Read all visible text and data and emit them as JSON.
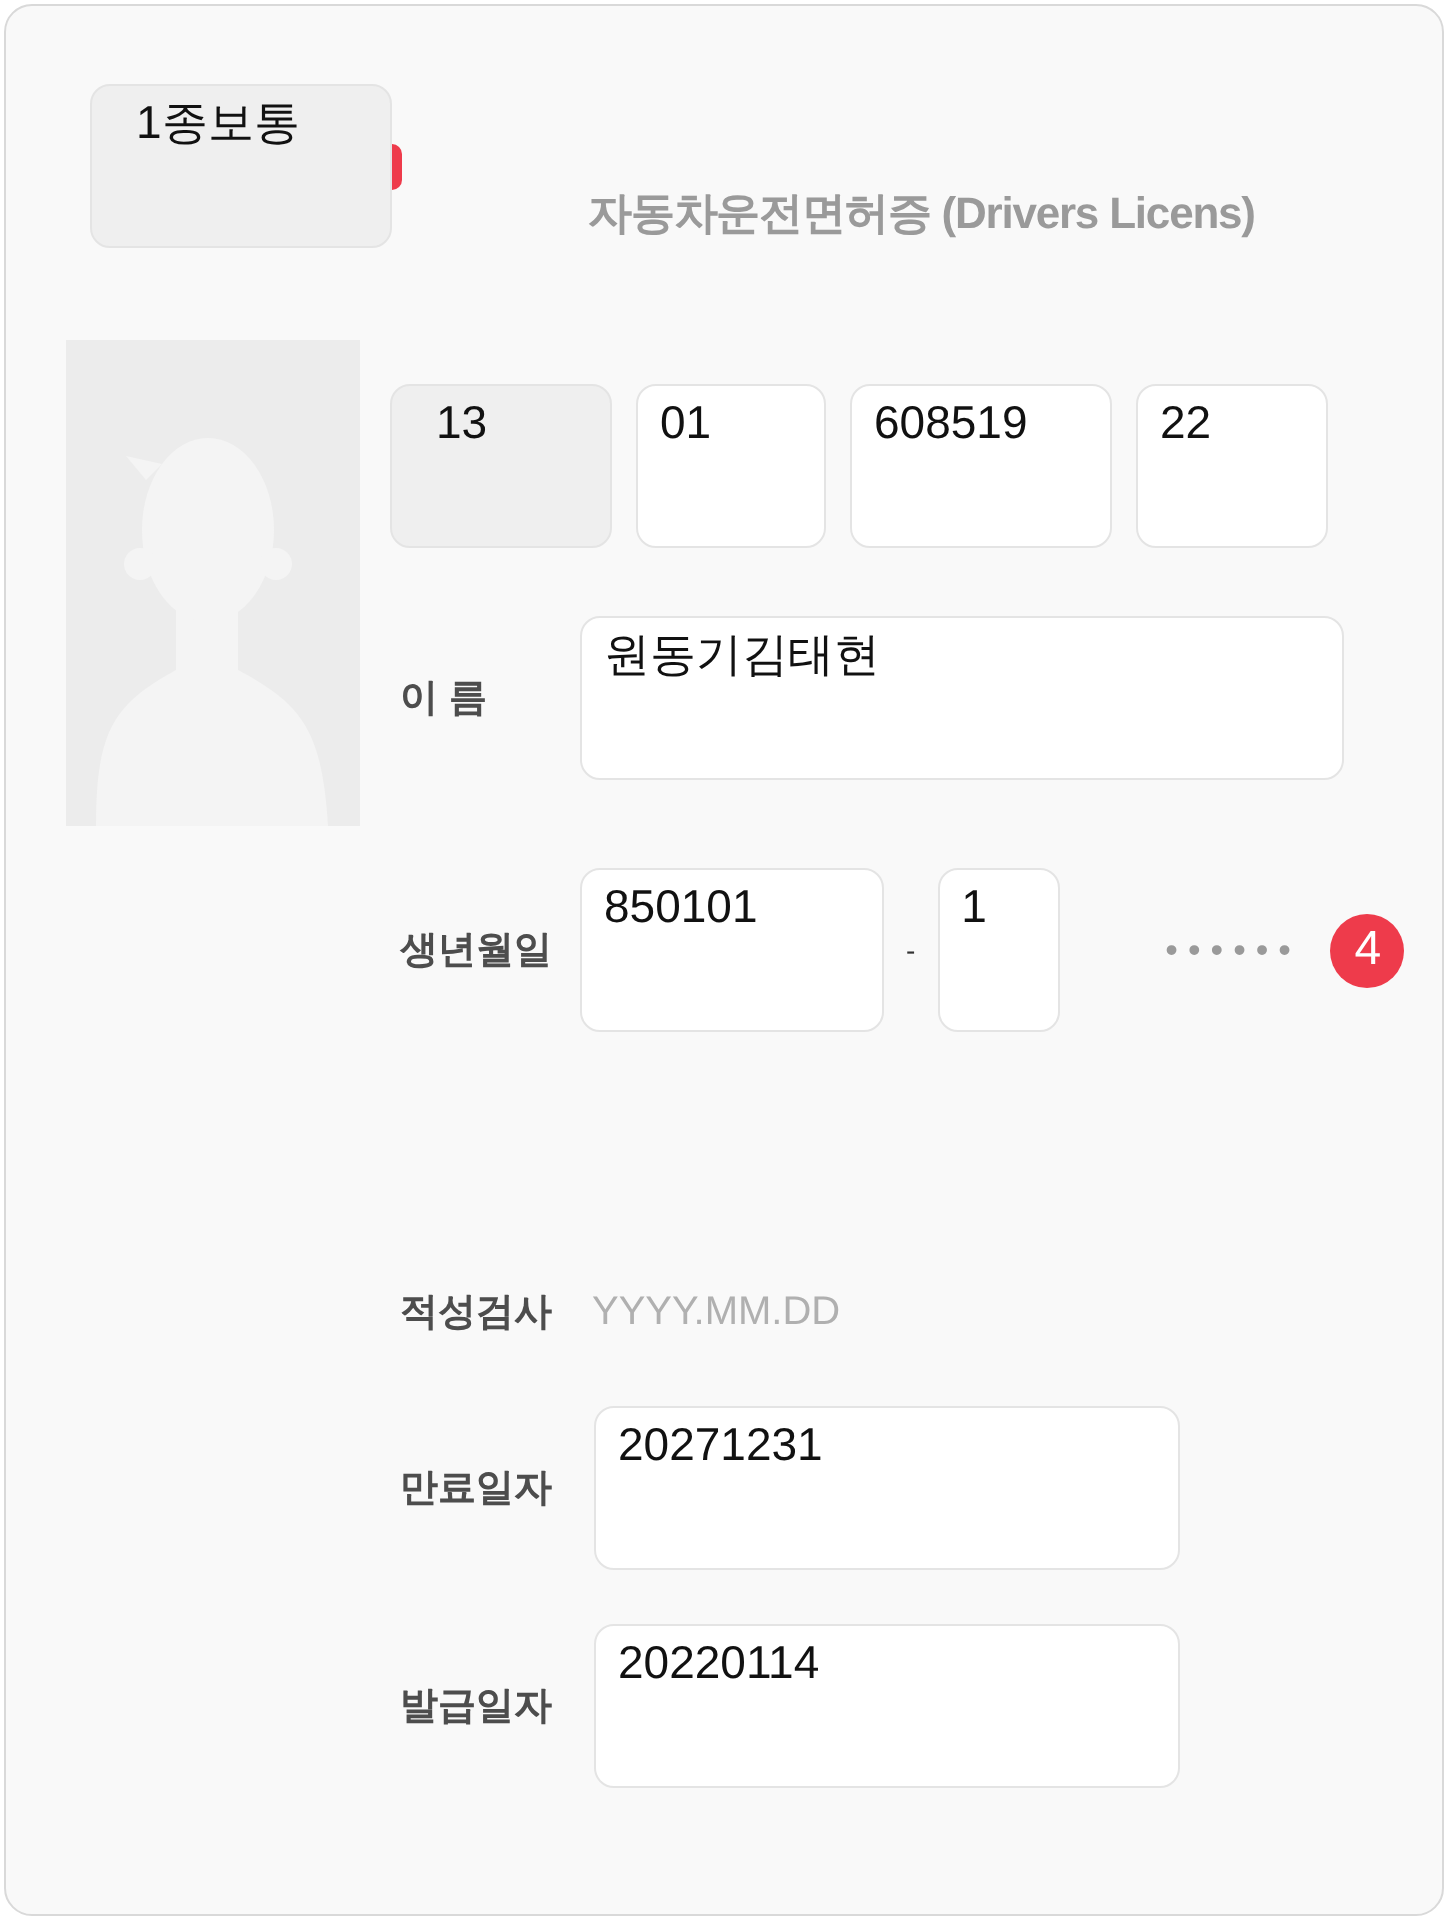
{
  "license_type": {
    "value": "1종보통",
    "disabled": true
  },
  "title": "자동차운전면허증 (Drivers Licens)",
  "license_number": [
    {
      "value": "13",
      "disabled": true
    },
    {
      "value": "01",
      "disabled": false
    },
    {
      "value": "608519",
      "disabled": false
    },
    {
      "value": "22",
      "disabled": false
    }
  ],
  "name": {
    "label": "이 름",
    "value": "원동기김태현"
  },
  "birth": {
    "label": "생년월일",
    "first": "850101",
    "separator": "-",
    "second": "1",
    "masked": "••••••",
    "badge": "4"
  },
  "aptitude_test": {
    "label": "적성검사",
    "placeholder": "YYYY.MM.DD"
  },
  "expiry": {
    "label": "만료일자",
    "value": "20271231"
  },
  "issue": {
    "label": "발급일자",
    "value": "20220114"
  }
}
